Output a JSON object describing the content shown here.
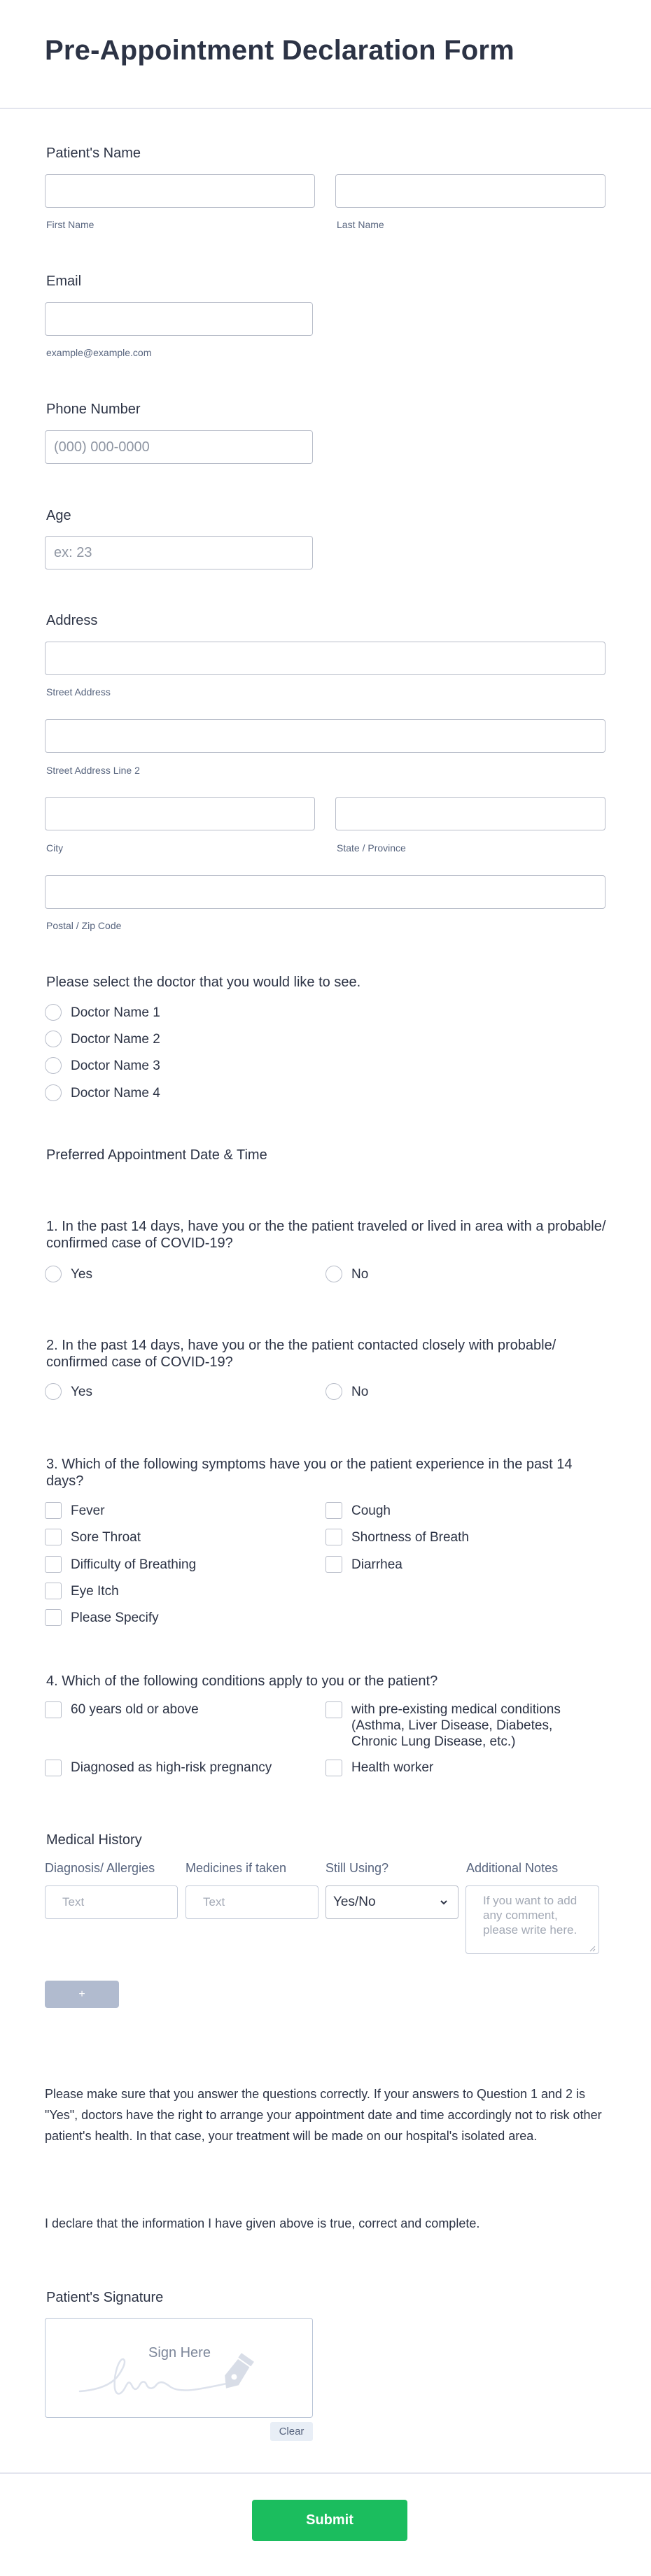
{
  "form": {
    "title": "Pre-Appointment Declaration Form"
  },
  "patient_name": {
    "label": "Patient's Name",
    "first_sublabel": "First Name",
    "last_sublabel": "Last Name",
    "first_value": "",
    "last_value": ""
  },
  "email": {
    "label": "Email",
    "sublabel": "example@example.com",
    "value": ""
  },
  "phone": {
    "label": "Phone Number",
    "placeholder": "(000) 000-0000",
    "value": ""
  },
  "age": {
    "label": "Age",
    "placeholder": "ex: 23",
    "value": ""
  },
  "address": {
    "label": "Address",
    "street_sublabel": "Street Address",
    "street2_sublabel": "Street Address Line 2",
    "city_sublabel": "City",
    "state_sublabel": "State / Province",
    "postal_sublabel": "Postal / Zip Code"
  },
  "doctor": {
    "question": "Please select the doctor that you would like to see.",
    "options": [
      "Doctor Name 1",
      "Doctor Name 2",
      "Doctor Name 3",
      "Doctor Name 4"
    ]
  },
  "appointment": {
    "label": "Preferred Appointment Date & Time"
  },
  "q1": {
    "question": "1. In the past 14 days, have you or the the patient traveled or lived in area with a probable/ confirmed case of COVID-19?",
    "options": [
      "Yes",
      "No"
    ]
  },
  "q2": {
    "question": "2. In the past 14 days, have you or the the patient contacted closely with probable/ confirmed case of COVID-19?",
    "options": [
      "Yes",
      "No"
    ]
  },
  "q3": {
    "question": "3. Which of the following symptoms have you or the patient experience in the past 14 days?",
    "options": [
      "Fever",
      "Cough",
      "Sore Throat",
      "Shortness of Breath",
      "Difficulty of Breathing",
      "Diarrhea",
      "Eye Itch",
      "Please Specify"
    ]
  },
  "q4": {
    "question": "4. Which of the following conditions apply to you or the patient?",
    "options": [
      "60 years old or above",
      "with pre-existing medical conditions (Asthma, Liver Disease, Diabetes, Chronic Lung Disease, etc.)",
      "Diagnosed as high-risk pregnancy",
      "Health worker"
    ]
  },
  "medical_history": {
    "label": "Medical History",
    "columns": [
      "Diagnosis/ Allergies",
      "Medicines if taken",
      "Still Using?",
      "Additional Notes"
    ],
    "text_placeholder": "Text",
    "select_value": "Yes/No",
    "notes_placeholder": "If you want to add any comment, please write here.",
    "add_label": "+"
  },
  "notice": {
    "text": "Please make sure that you answer the questions correctly. If your answers to Question 1 and 2 is \"Yes\", doctors have the right to arrange your appointment date and time accordingly not to risk other patient's health. In that case, your treatment will be made on our hospital's isolated area."
  },
  "declaration": {
    "text": "I declare that the information I have given above is true, correct and complete."
  },
  "signature": {
    "label": "Patient's Signature",
    "hint": "Sign Here",
    "clear_label": "Clear"
  },
  "submit": {
    "label": "Submit",
    "color": "#1bbd5e"
  }
}
